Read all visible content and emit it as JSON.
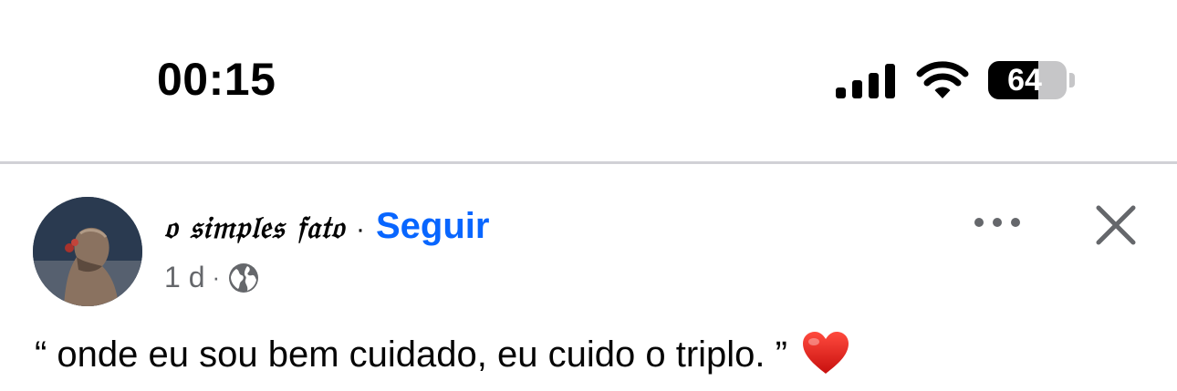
{
  "status_bar": {
    "time": "00:15",
    "battery_percent": "64",
    "battery_level": 0.64,
    "signal_bars": 4,
    "icons": [
      "cellular-signal-icon",
      "wifi-icon",
      "battery-icon"
    ]
  },
  "post": {
    "author": {
      "name": "𝔬 𝔰𝔦𝔪𝔭𝔩𝔢𝔰 𝔣𝔞𝔱𝔬",
      "separator": "·",
      "follow_label": "Seguir",
      "avatar_icon": "avatar"
    },
    "meta": {
      "time_ago": "1 d",
      "separator": "·",
      "privacy_icon": "globe-icon"
    },
    "actions": {
      "more_icon": "more-options-icon",
      "close_icon": "close-icon"
    },
    "text": "“ onde eu sou bem cuidado, eu cuido o triplo. ”",
    "emoji_icon": "red-heart-icon"
  },
  "colors": {
    "follow_link": "#0866ff",
    "meta_text": "#65676b",
    "divider": "#d1d1d6",
    "heart": "#e0201c"
  }
}
